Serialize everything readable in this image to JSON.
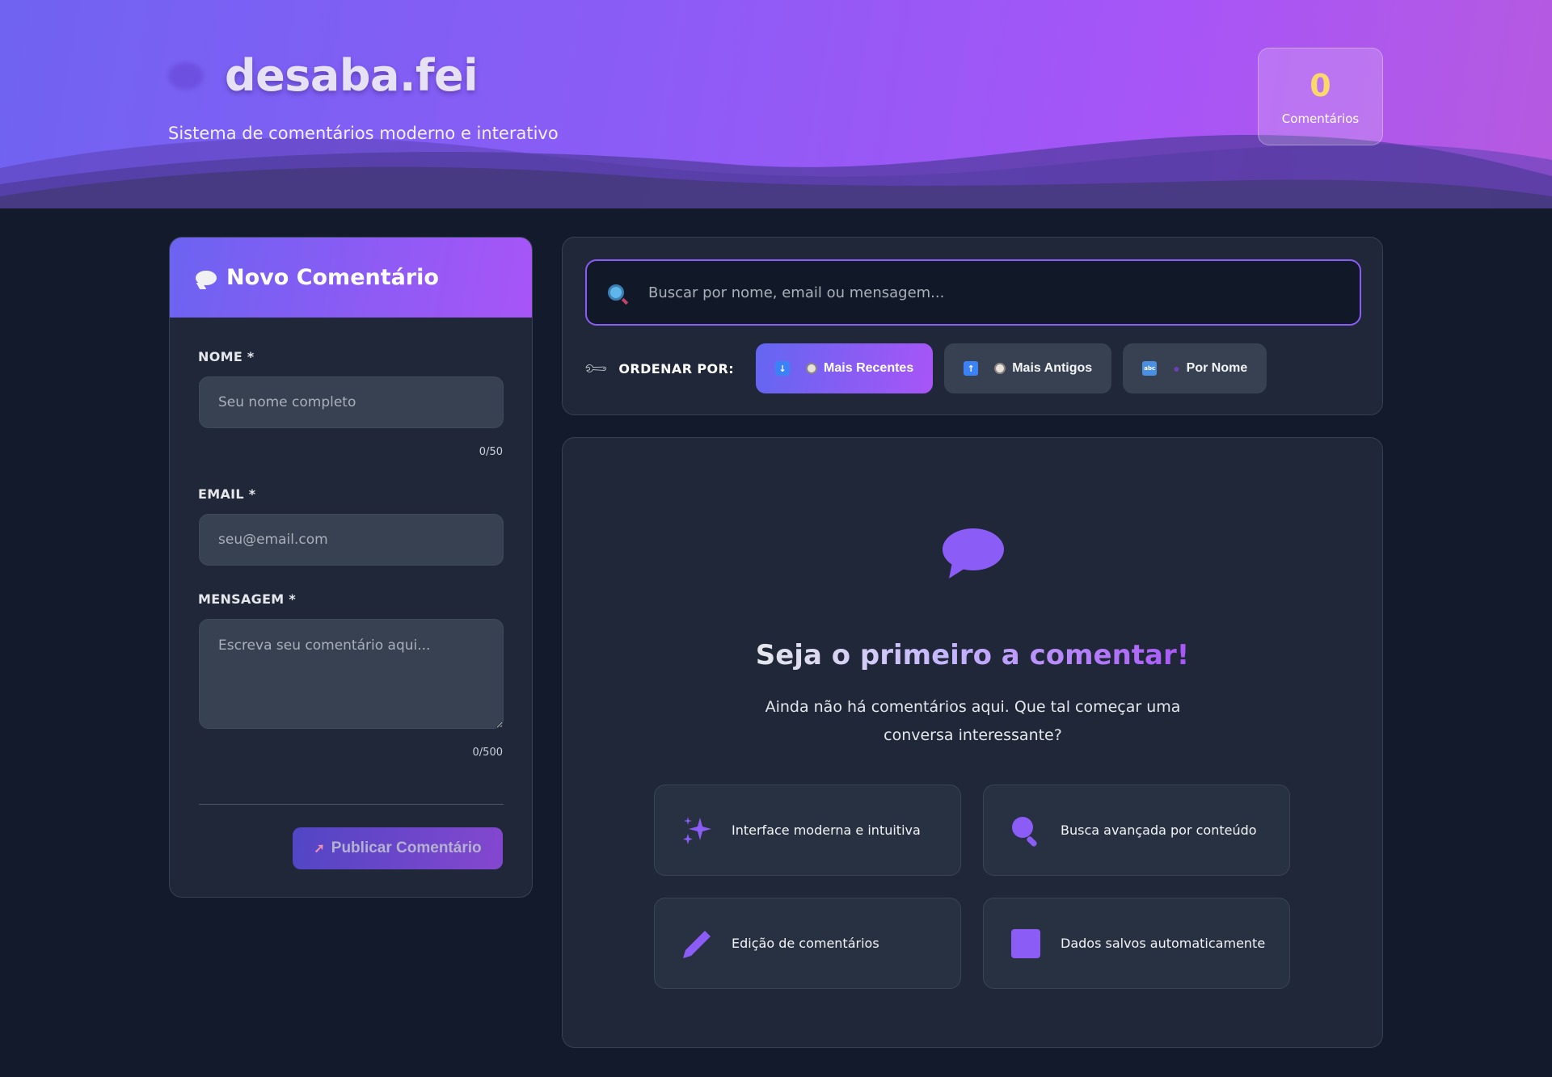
{
  "header": {
    "brand": "desaba.fei",
    "subtitle": "Sistema de comentários moderno e interativo",
    "counter_value": "0",
    "counter_label": "Comentários"
  },
  "form": {
    "title": "Novo Comentário",
    "name_label": "NOME *",
    "name_placeholder": "Seu nome completo",
    "name_count": "0/50",
    "email_label": "EMAIL *",
    "email_placeholder": "seu@email.com",
    "message_label": "MENSAGEM *",
    "message_placeholder": "Escreva seu comentário aqui...",
    "message_count": "0/500",
    "publish_label": "Publicar Comentário"
  },
  "search": {
    "placeholder": "Buscar por nome, email ou mensagem...",
    "sort_label": "ORDENAR POR:",
    "sort_options": [
      {
        "label": "Mais Recentes",
        "active": true
      },
      {
        "label": "Mais Antigos",
        "active": false
      },
      {
        "label": "Por Nome",
        "active": false
      }
    ]
  },
  "empty_state": {
    "title": "Seja o primeiro a comentar!",
    "description": "Ainda não há comentários aqui. Que tal começar uma conversa interessante?",
    "features": [
      {
        "label": "Interface moderna e intuitiva",
        "icon": "sparkles-icon"
      },
      {
        "label": "Busca avançada por conteúdo",
        "icon": "magnifier-icon"
      },
      {
        "label": "Edição de comentários",
        "icon": "pencil-icon"
      },
      {
        "label": "Dados salvos automaticamente",
        "icon": "square-icon"
      }
    ]
  },
  "colors": {
    "accent": "#8b5cf6",
    "accent_blue": "#6366f1",
    "counter": "#fcd86b",
    "background": "#131a2b",
    "card": "#1f2738"
  }
}
